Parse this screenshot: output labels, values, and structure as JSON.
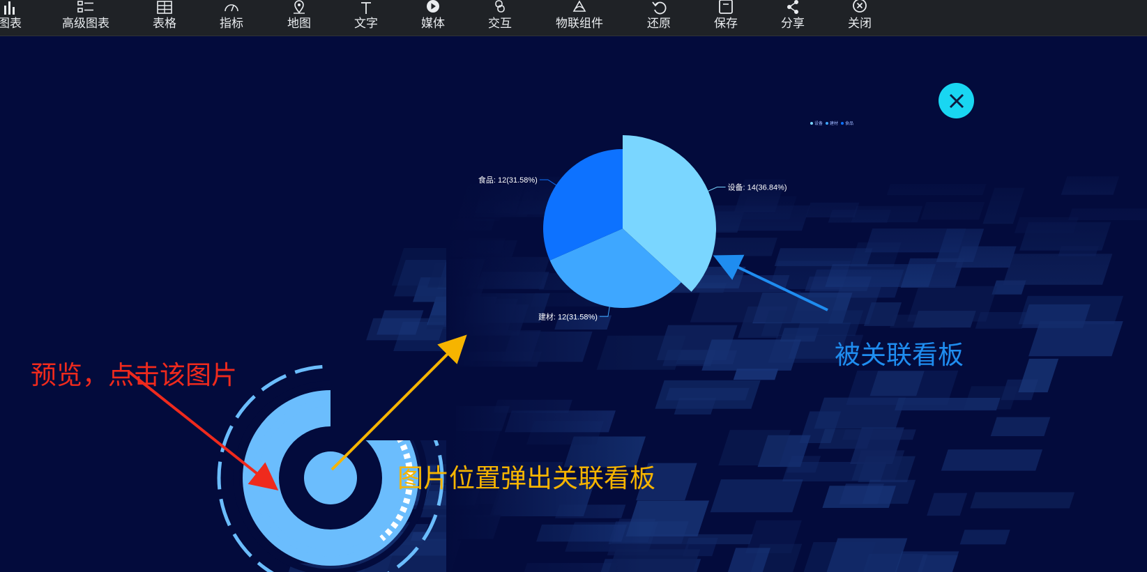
{
  "toolbar": {
    "items": [
      {
        "label": "图表",
        "icon": "bar-chart-icon"
      },
      {
        "label": "高级图表",
        "icon": "advanced-chart-icon"
      },
      {
        "label": "表格",
        "icon": "table-icon"
      },
      {
        "label": "指标",
        "icon": "gauge-icon"
      },
      {
        "label": "地图",
        "icon": "map-pin-icon"
      },
      {
        "label": "文字",
        "icon": "text-icon"
      },
      {
        "label": "媒体",
        "icon": "play-icon"
      },
      {
        "label": "交互",
        "icon": "link-icon"
      },
      {
        "label": "物联组件",
        "icon": "iot-icon"
      },
      {
        "label": "还原",
        "icon": "undo-icon"
      },
      {
        "label": "保存",
        "icon": "save-icon"
      },
      {
        "label": "分享",
        "icon": "share-icon"
      },
      {
        "label": "关闭",
        "icon": "close-circle-icon"
      }
    ]
  },
  "annotations": {
    "preview_click": "预览，点击该图片",
    "popup_position": "图片位置弹出关联看板",
    "linked_board": "被关联看板"
  },
  "chart_data": {
    "type": "pie",
    "categories": [
      "设备",
      "建材",
      "食品"
    ],
    "values": [
      14,
      12,
      12
    ],
    "labels": [
      "设备: 14(36.84%)",
      "建材: 12(31.58%)",
      "食品: 12(31.58%)"
    ],
    "colors": [
      "#7ad6ff",
      "#3ea7ff",
      "#0d72ff"
    ],
    "legend": [
      "设备",
      "建材",
      "食品"
    ],
    "legend_placement": "top-right"
  },
  "colors": {
    "background": "#030b3c",
    "toolbar": "#1f2226",
    "close_button": "#19d6f2",
    "ring": "#6bbdfd",
    "red_arrow": "#ef2a1d",
    "yellow_arrow": "#f6b400",
    "blue_arrow": "#1f8df0"
  }
}
